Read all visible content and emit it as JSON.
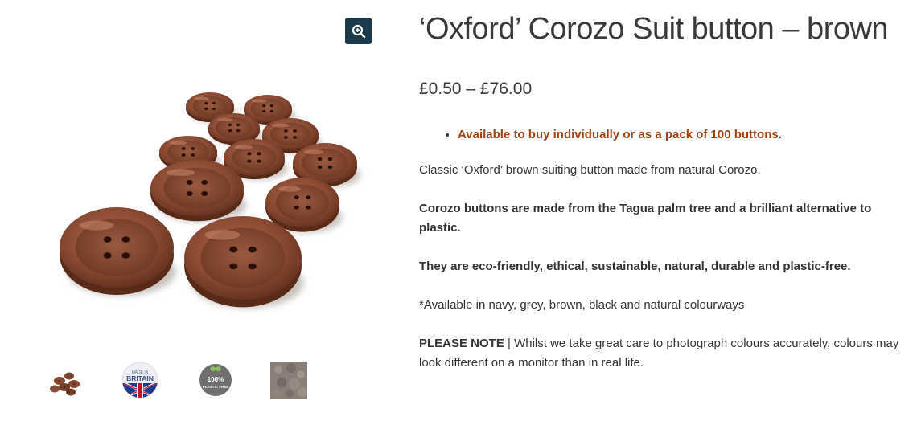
{
  "product": {
    "title": "‘Oxford’ Corozo Suit button – brown",
    "price": "£0.50 – £76.00"
  },
  "gallery": {
    "zoom_icon": "magnify-plus-icon",
    "thumbnails": [
      {
        "name": "buttons-photo",
        "alt": "brown buttons"
      },
      {
        "name": "made-in-britain-badge",
        "line1": "MADE IN",
        "line2": "BRITAIN"
      },
      {
        "name": "plastic-free-badge",
        "line1": "100%",
        "line2": "PLASTIC FREE"
      },
      {
        "name": "texture-photo",
        "alt": "corozo texture"
      }
    ]
  },
  "description": {
    "bullet": "Available to buy individually or as a pack of 100 buttons.",
    "p1": "Classic ‘Oxford’ brown suiting button made from natural Corozo.",
    "p2": "Corozo buttons are made from the Tagua palm tree and a brilliant alternative to plastic.",
    "p3": "They are eco-friendly, ethical, sustainable, natural, durable and plastic-free.",
    "p4": "*Available in navy, grey, brown, black and natural colourways",
    "note_label": "PLEASE NOTE",
    "note_text": " | Whilst we take great care to photograph colours accurately, colours may look different on a monitor than in real life."
  },
  "colors": {
    "accent": "#a0410d",
    "zoom_bg": "#1c3a4a",
    "button_brown": "#8a4a32"
  }
}
